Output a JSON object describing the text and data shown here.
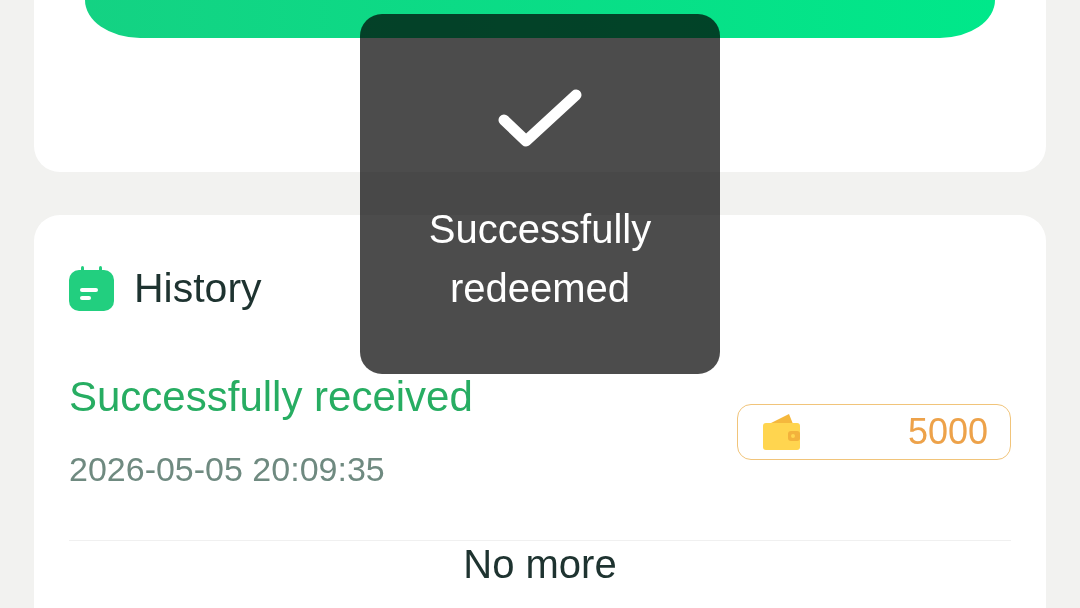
{
  "toast": {
    "message": "Successfully redeemed"
  },
  "history": {
    "title": "History",
    "records": [
      {
        "status": "Successfully received",
        "time": "2026-05-05 20:09:35",
        "amount": "5000"
      }
    ],
    "footer": "No more"
  }
}
